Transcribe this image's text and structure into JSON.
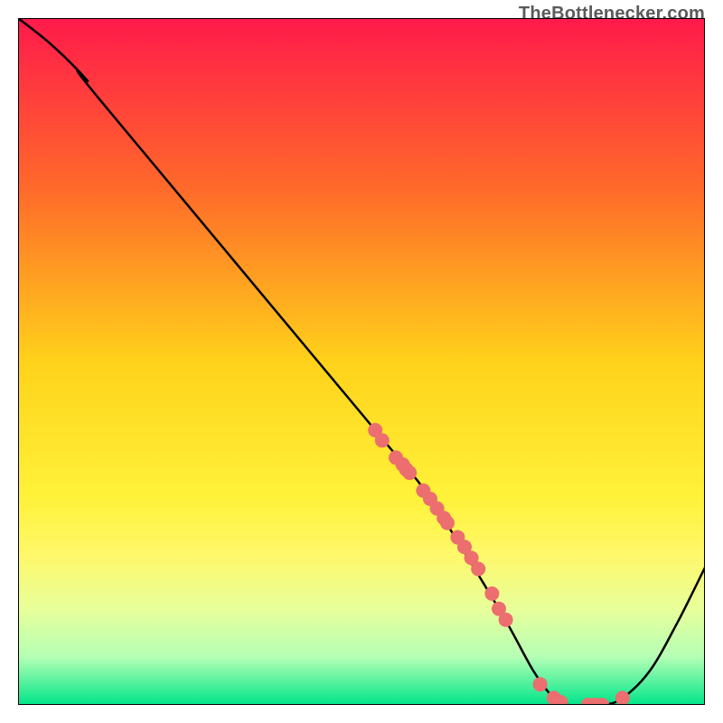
{
  "attribution": "TheBottlenecker.com",
  "chart_data": {
    "type": "line",
    "title": "",
    "xlabel": "",
    "ylabel": "",
    "xlim": [
      0,
      100
    ],
    "ylim": [
      0,
      100
    ],
    "gradient_stops": [
      {
        "offset": 0,
        "color": "#ff1a4b"
      },
      {
        "offset": 25,
        "color": "#ff6a2a"
      },
      {
        "offset": 50,
        "color": "#ffd21a"
      },
      {
        "offset": 70,
        "color": "#fff23a"
      },
      {
        "offset": 78,
        "color": "#fff86a"
      },
      {
        "offset": 86,
        "color": "#e8ff9a"
      },
      {
        "offset": 93,
        "color": "#b5ffb5"
      },
      {
        "offset": 100,
        "color": "#00e58a"
      }
    ],
    "series": [
      {
        "name": "curve",
        "color": "#000000",
        "points": [
          {
            "x": 0,
            "y": 100
          },
          {
            "x": 5,
            "y": 96
          },
          {
            "x": 10,
            "y": 91
          },
          {
            "x": 12,
            "y": 88
          },
          {
            "x": 52,
            "y": 40
          },
          {
            "x": 60,
            "y": 30
          },
          {
            "x": 70,
            "y": 14
          },
          {
            "x": 75,
            "y": 5
          },
          {
            "x": 78,
            "y": 1
          },
          {
            "x": 80,
            "y": 0
          },
          {
            "x": 85,
            "y": 0
          },
          {
            "x": 88,
            "y": 1
          },
          {
            "x": 92,
            "y": 5
          },
          {
            "x": 96,
            "y": 12
          },
          {
            "x": 100,
            "y": 20
          }
        ]
      }
    ],
    "markers": {
      "color": "#ec6e6e",
      "radius": 8,
      "points": [
        {
          "x": 52,
          "y": 40
        },
        {
          "x": 53,
          "y": 38.5
        },
        {
          "x": 55,
          "y": 36
        },
        {
          "x": 56,
          "y": 35
        },
        {
          "x": 56.5,
          "y": 34.3
        },
        {
          "x": 57,
          "y": 33.8
        },
        {
          "x": 59,
          "y": 31.2
        },
        {
          "x": 60,
          "y": 30
        },
        {
          "x": 61,
          "y": 28.6
        },
        {
          "x": 62,
          "y": 27.2
        },
        {
          "x": 62.5,
          "y": 26.5
        },
        {
          "x": 64,
          "y": 24.4
        },
        {
          "x": 65,
          "y": 23
        },
        {
          "x": 66,
          "y": 21.4
        },
        {
          "x": 67,
          "y": 19.8
        },
        {
          "x": 69,
          "y": 16.2
        },
        {
          "x": 70,
          "y": 14
        },
        {
          "x": 71,
          "y": 12.4
        },
        {
          "x": 76,
          "y": 3
        },
        {
          "x": 78,
          "y": 1
        },
        {
          "x": 79,
          "y": 0.4
        },
        {
          "x": 83,
          "y": 0
        },
        {
          "x": 84,
          "y": 0
        },
        {
          "x": 85,
          "y": 0
        },
        {
          "x": 88,
          "y": 1
        }
      ]
    }
  }
}
